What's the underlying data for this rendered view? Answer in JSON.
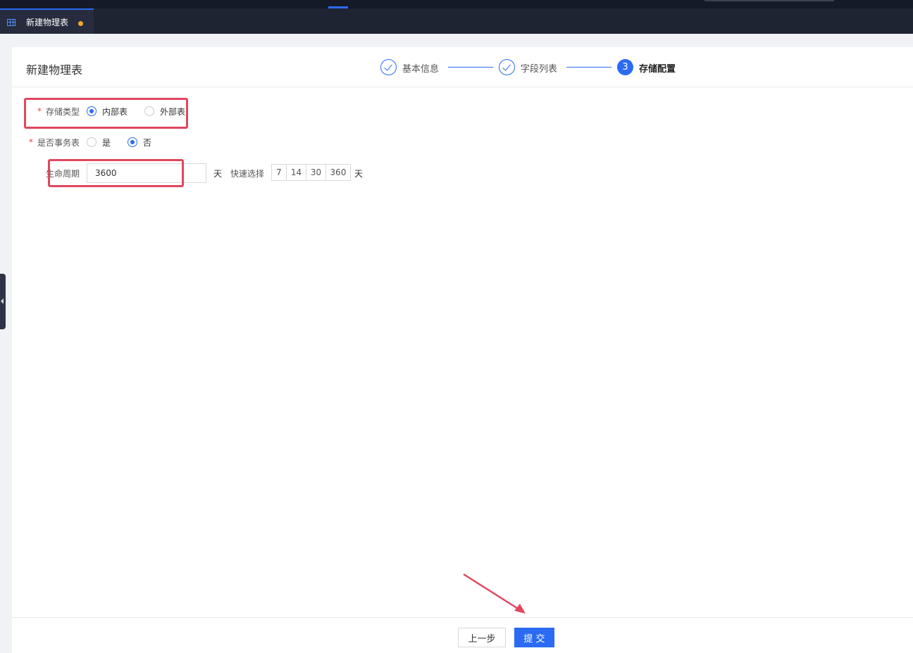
{
  "tab": {
    "label": "新建物理表",
    "icon": "table-grid-icon",
    "unsaved_dot_color": "#f5a623"
  },
  "page": {
    "title": "新建物理表"
  },
  "steps": [
    {
      "label": "基本信息",
      "status": "done"
    },
    {
      "label": "字段列表",
      "status": "done"
    },
    {
      "label": "存储配置",
      "status": "active",
      "number": "3"
    }
  ],
  "form": {
    "storage_type": {
      "required_mark": "*",
      "label": "存储类型",
      "options": [
        {
          "label": "内部表",
          "checked": true
        },
        {
          "label": "外部表",
          "checked": false
        }
      ]
    },
    "transactional": {
      "required_mark": "*",
      "label": "是否事务表",
      "options": [
        {
          "label": "是",
          "checked": false
        },
        {
          "label": "否",
          "checked": true
        }
      ]
    },
    "lifecycle": {
      "label": "生命周期",
      "value": "3600",
      "unit": "天",
      "quick_label": "快速选择",
      "quick_options": [
        "7",
        "14",
        "30",
        "360"
      ],
      "quick_unit": "天"
    }
  },
  "footer": {
    "prev_label": "上一步",
    "submit_label": "提 交"
  },
  "colors": {
    "accent": "#2b6bf3",
    "highlight": "#e0475e",
    "topbar": "#141a27"
  }
}
